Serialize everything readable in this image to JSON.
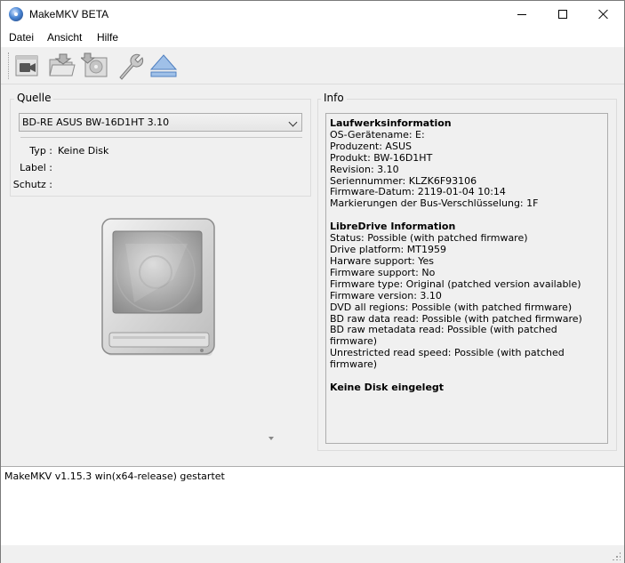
{
  "window": {
    "title": "MakeMKV BETA"
  },
  "menu": {
    "file": "Datei",
    "view": "Ansicht",
    "help": "Hilfe"
  },
  "toolbar": {
    "buttons": [
      {
        "icon": "open-video-icon"
      },
      {
        "icon": "open-files-icon"
      },
      {
        "icon": "backup-disc-icon"
      },
      {
        "icon": "settings-wrench-icon"
      },
      {
        "icon": "eject-icon"
      }
    ]
  },
  "source": {
    "group_label": "Quelle",
    "drive_selected": "BD-RE ASUS BW-16D1HT 3.10",
    "type_label": "Typ :",
    "type_value": "Keine Disk",
    "label_label": "Label :",
    "label_value": "",
    "protection_label": "Schutz :",
    "protection_value": ""
  },
  "info": {
    "group_label": "Info",
    "drive_heading": "Laufwerksinformation",
    "drive_lines": [
      "OS-Gerätename: E:",
      "Produzent: ASUS",
      "Produkt: BW-16D1HT",
      "Revision: 3.10",
      "Seriennummer: KLZK6F93106",
      "Firmware-Datum: 2119-01-04 10:14",
      "Markierungen der Bus-Verschlüsselung: 1F"
    ],
    "libre_heading": "LibreDrive Information",
    "libre_lines": [
      "Status: Possible (with patched firmware)",
      "Drive platform: MT1959",
      "Harware support: Yes",
      "Firmware support: No",
      "Firmware type: Original (patched version available)",
      "Firmware version: 3.10",
      "DVD all regions: Possible (with patched firmware)",
      "BD raw data read: Possible (with patched firmware)",
      "BD raw metadata read: Possible (with patched firmware)",
      "Unrestricted read speed: Possible (with patched firmware)"
    ],
    "disc_status": "Keine Disk eingelegt"
  },
  "log": {
    "lines": [
      "MakeMKV v1.15.3 win(x64-release) gestartet"
    ]
  }
}
